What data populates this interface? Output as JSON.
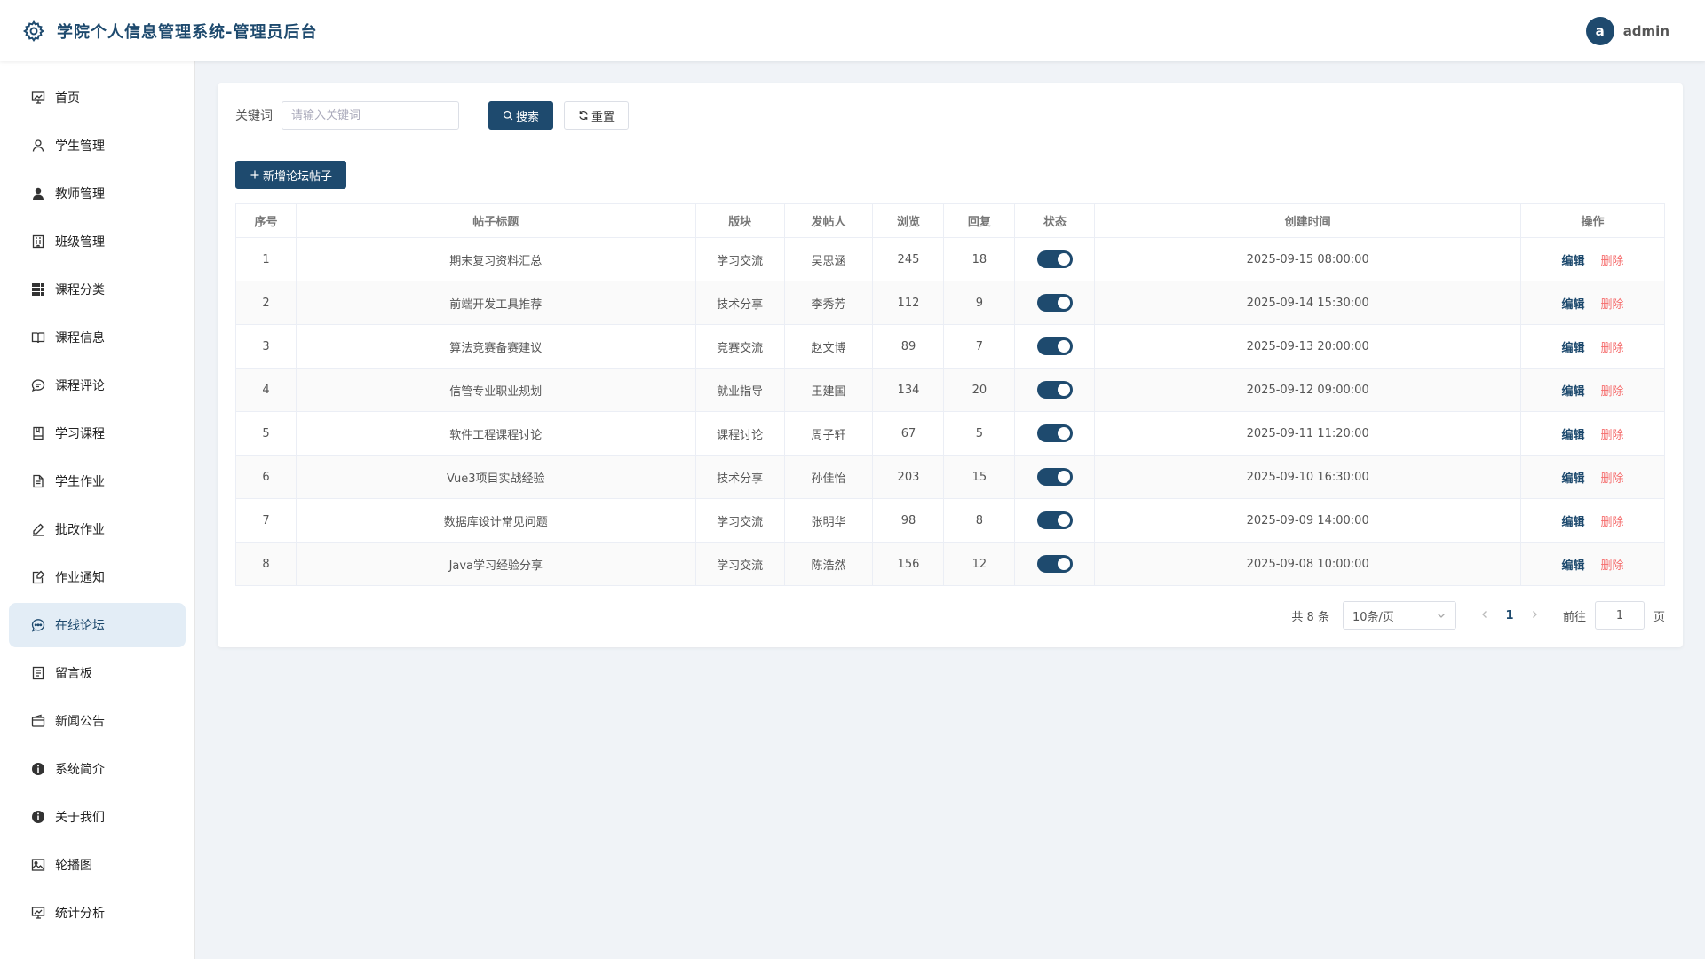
{
  "header": {
    "title": "学院个人信息管理系统-管理员后台",
    "avatar_letter": "a",
    "username": "admin"
  },
  "sidebar": {
    "items": [
      {
        "label": "首页",
        "icon": "presentation-chart-icon"
      },
      {
        "label": "学生管理",
        "icon": "user-outline-icon"
      },
      {
        "label": "教师管理",
        "icon": "user-filled-icon"
      },
      {
        "label": "班级管理",
        "icon": "building-icon"
      },
      {
        "label": "课程分类",
        "icon": "grid-icon"
      },
      {
        "label": "课程信息",
        "icon": "book-icon"
      },
      {
        "label": "课程评论",
        "icon": "chat-bubble-icon"
      },
      {
        "label": "学习课程",
        "icon": "notebook-icon"
      },
      {
        "label": "学生作业",
        "icon": "document-icon"
      },
      {
        "label": "批改作业",
        "icon": "pen-icon"
      },
      {
        "label": "作业通知",
        "icon": "note-icon"
      },
      {
        "label": "在线论坛",
        "icon": "chat-dots-icon",
        "active": true
      },
      {
        "label": "留言板",
        "icon": "list-document-icon"
      },
      {
        "label": "新闻公告",
        "icon": "wallet-icon"
      },
      {
        "label": "系统简介",
        "icon": "info-icon"
      },
      {
        "label": "关于我们",
        "icon": "info-icon"
      },
      {
        "label": "轮播图",
        "icon": "picture-icon"
      },
      {
        "label": "统计分析",
        "icon": "presentation-chart-icon"
      }
    ]
  },
  "search": {
    "label": "关键词",
    "placeholder": "请输入关键词",
    "search_button": "搜索",
    "reset_button": "重置"
  },
  "add_button": "新增论坛帖子",
  "table": {
    "columns": [
      "序号",
      "帖子标题",
      "版块",
      "发帖人",
      "浏览",
      "回复",
      "状态",
      "创建时间",
      "操作"
    ],
    "rows": [
      {
        "no": "1",
        "title": "期末复习资料汇总",
        "board": "学习交流",
        "author": "吴思涵",
        "views": "245",
        "replies": "18",
        "enabled": true,
        "created": "2025-09-15 08:00:00"
      },
      {
        "no": "2",
        "title": "前端开发工具推荐",
        "board": "技术分享",
        "author": "李秀芳",
        "views": "112",
        "replies": "9",
        "enabled": true,
        "created": "2025-09-14 15:30:00"
      },
      {
        "no": "3",
        "title": "算法竞赛备赛建议",
        "board": "竞赛交流",
        "author": "赵文博",
        "views": "89",
        "replies": "7",
        "enabled": true,
        "created": "2025-09-13 20:00:00"
      },
      {
        "no": "4",
        "title": "信管专业职业规划",
        "board": "就业指导",
        "author": "王建国",
        "views": "134",
        "replies": "20",
        "enabled": true,
        "created": "2025-09-12 09:00:00"
      },
      {
        "no": "5",
        "title": "软件工程课程讨论",
        "board": "课程讨论",
        "author": "周子轩",
        "views": "67",
        "replies": "5",
        "enabled": true,
        "created": "2025-09-11 11:20:00"
      },
      {
        "no": "6",
        "title": "Vue3项目实战经验",
        "board": "技术分享",
        "author": "孙佳怡",
        "views": "203",
        "replies": "15",
        "enabled": true,
        "created": "2025-09-10 16:30:00"
      },
      {
        "no": "7",
        "title": "数据库设计常见问题",
        "board": "学习交流",
        "author": "张明华",
        "views": "98",
        "replies": "8",
        "enabled": true,
        "created": "2025-09-09 14:00:00"
      },
      {
        "no": "8",
        "title": "Java学习经验分享",
        "board": "学习交流",
        "author": "陈浩然",
        "views": "156",
        "replies": "12",
        "enabled": true,
        "created": "2025-09-08 10:00:00"
      }
    ],
    "edit_label": "编辑",
    "delete_label": "删除"
  },
  "pagination": {
    "total_text": "共 8 条",
    "page_size": "10条/页",
    "current_page": "1",
    "goto_label": "前往",
    "goto_value": "1",
    "page_suffix": "页"
  },
  "colors": {
    "primary": "#1e4a6e",
    "danger": "#f56c6c",
    "active_bg": "#e3edf6"
  }
}
